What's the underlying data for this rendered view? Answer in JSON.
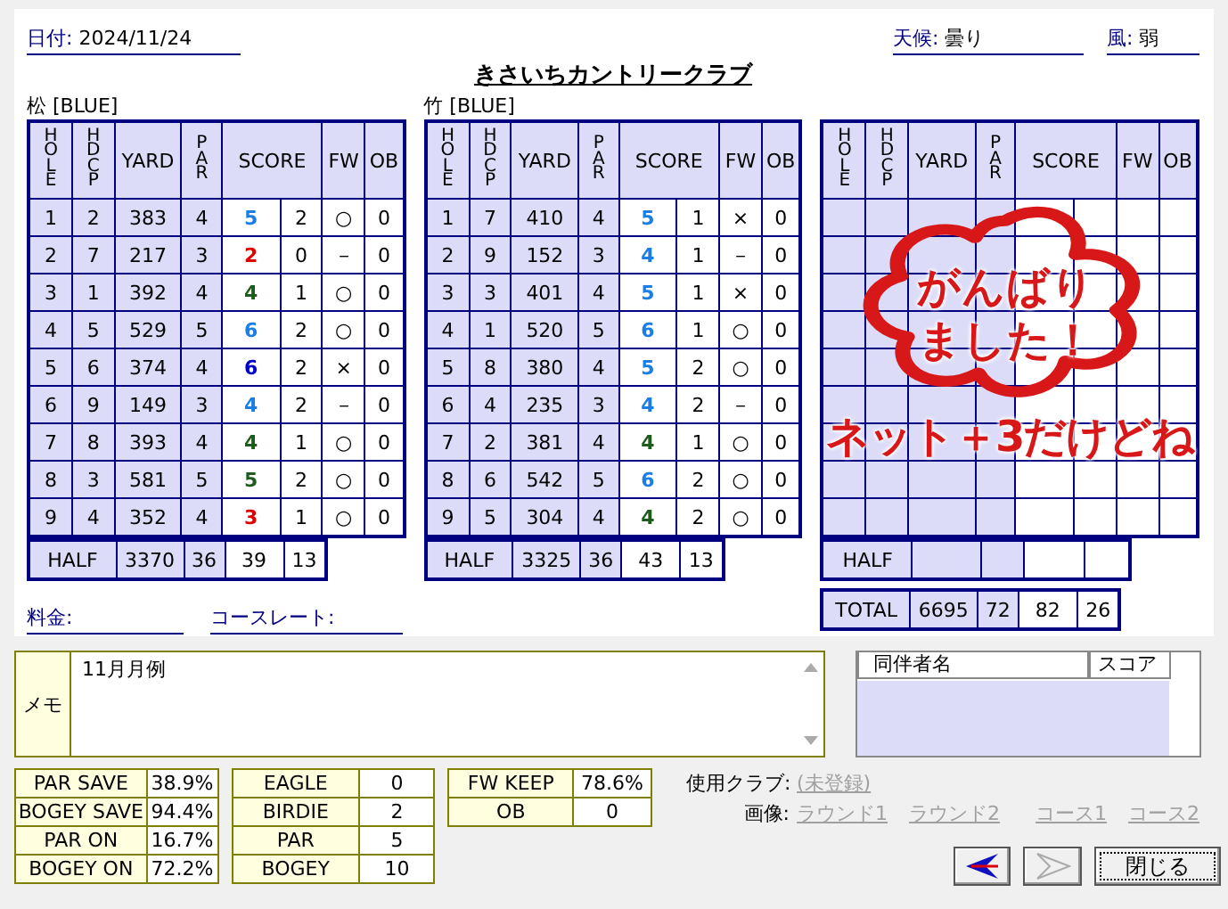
{
  "header": {
    "date_label": "日付:",
    "date": "2024/11/24",
    "weather_label": "天候:",
    "weather": "曇り",
    "wind_label": "風:",
    "wind": "弱"
  },
  "course_name": "きさいちカントリークラブ",
  "cards": [
    {
      "title": "松 [BLUE]",
      "columns": [
        "HOLE",
        "HDCP",
        "YARD",
        "PAR",
        "SCORE",
        "FW",
        "OB"
      ],
      "holes": [
        {
          "hole": "1",
          "hdcp": "2",
          "yard": "383",
          "par": "4",
          "score": "5",
          "putts": "2",
          "fw": "○",
          "ob": "0",
          "color": "#1a7ee6"
        },
        {
          "hole": "2",
          "hdcp": "7",
          "yard": "217",
          "par": "3",
          "score": "2",
          "putts": "0",
          "fw": "－",
          "ob": "0",
          "color": "#e00000"
        },
        {
          "hole": "3",
          "hdcp": "1",
          "yard": "392",
          "par": "4",
          "score": "4",
          "putts": "1",
          "fw": "○",
          "ob": "0",
          "color": "#1e5c1e"
        },
        {
          "hole": "4",
          "hdcp": "5",
          "yard": "529",
          "par": "5",
          "score": "6",
          "putts": "2",
          "fw": "○",
          "ob": "0",
          "color": "#1a7ee6"
        },
        {
          "hole": "5",
          "hdcp": "6",
          "yard": "374",
          "par": "4",
          "score": "6",
          "putts": "2",
          "fw": "×",
          "ob": "0",
          "color": "#0000cc"
        },
        {
          "hole": "6",
          "hdcp": "9",
          "yard": "149",
          "par": "3",
          "score": "4",
          "putts": "2",
          "fw": "－",
          "ob": "0",
          "color": "#1a7ee6"
        },
        {
          "hole": "7",
          "hdcp": "8",
          "yard": "393",
          "par": "4",
          "score": "4",
          "putts": "1",
          "fw": "○",
          "ob": "0",
          "color": "#1e5c1e"
        },
        {
          "hole": "8",
          "hdcp": "3",
          "yard": "581",
          "par": "5",
          "score": "5",
          "putts": "2",
          "fw": "○",
          "ob": "0",
          "color": "#1e5c1e"
        },
        {
          "hole": "9",
          "hdcp": "4",
          "yard": "352",
          "par": "4",
          "score": "3",
          "putts": "1",
          "fw": "○",
          "ob": "0",
          "color": "#e00000"
        }
      ],
      "half": {
        "label": "HALF",
        "yard": "3370",
        "par": "36",
        "score": "39",
        "putts": "13"
      }
    },
    {
      "title": "竹 [BLUE]",
      "columns": [
        "HOLE",
        "HDCP",
        "YARD",
        "PAR",
        "SCORE",
        "FW",
        "OB"
      ],
      "holes": [
        {
          "hole": "1",
          "hdcp": "7",
          "yard": "410",
          "par": "4",
          "score": "5",
          "putts": "1",
          "fw": "×",
          "ob": "0",
          "color": "#1a7ee6"
        },
        {
          "hole": "2",
          "hdcp": "9",
          "yard": "152",
          "par": "3",
          "score": "4",
          "putts": "1",
          "fw": "－",
          "ob": "0",
          "color": "#1a7ee6"
        },
        {
          "hole": "3",
          "hdcp": "3",
          "yard": "401",
          "par": "4",
          "score": "5",
          "putts": "1",
          "fw": "×",
          "ob": "0",
          "color": "#1a7ee6"
        },
        {
          "hole": "4",
          "hdcp": "1",
          "yard": "520",
          "par": "5",
          "score": "6",
          "putts": "1",
          "fw": "○",
          "ob": "0",
          "color": "#1a7ee6"
        },
        {
          "hole": "5",
          "hdcp": "8",
          "yard": "380",
          "par": "4",
          "score": "5",
          "putts": "2",
          "fw": "○",
          "ob": "0",
          "color": "#1a7ee6"
        },
        {
          "hole": "6",
          "hdcp": "4",
          "yard": "235",
          "par": "3",
          "score": "4",
          "putts": "2",
          "fw": "－",
          "ob": "0",
          "color": "#1a7ee6"
        },
        {
          "hole": "7",
          "hdcp": "2",
          "yard": "381",
          "par": "4",
          "score": "4",
          "putts": "1",
          "fw": "○",
          "ob": "0",
          "color": "#1e5c1e"
        },
        {
          "hole": "8",
          "hdcp": "6",
          "yard": "542",
          "par": "5",
          "score": "6",
          "putts": "2",
          "fw": "○",
          "ob": "0",
          "color": "#1a7ee6"
        },
        {
          "hole": "9",
          "hdcp": "5",
          "yard": "304",
          "par": "4",
          "score": "4",
          "putts": "2",
          "fw": "○",
          "ob": "0",
          "color": "#1e5c1e"
        }
      ],
      "half": {
        "label": "HALF",
        "yard": "3325",
        "par": "36",
        "score": "43",
        "putts": "13"
      }
    },
    {
      "columns": [
        "HOLE",
        "HDCP",
        "YARD",
        "PAR",
        "SCORE",
        "FW",
        "OB"
      ],
      "half": {
        "label": "HALF"
      }
    }
  ],
  "total": {
    "label": "TOTAL",
    "yard": "6695",
    "par": "72",
    "score": "82",
    "putts": "26"
  },
  "fee_label": "料金:",
  "course_rate_label": "コースレート:",
  "stamp": {
    "lines": [
      "がんばり",
      "ました！"
    ],
    "note": "ネット＋3だけどね"
  },
  "memo": {
    "label": "メモ",
    "value": "11月月例"
  },
  "companions": {
    "columns": [
      "同伴者名",
      "スコア"
    ]
  },
  "stats": [
    [
      {
        "label": "PAR SAVE",
        "value": "38.9%"
      },
      {
        "label": "BOGEY SAVE",
        "value": "94.4%"
      },
      {
        "label": "PAR ON",
        "value": "16.7%"
      },
      {
        "label": "BOGEY ON",
        "value": "72.2%"
      }
    ],
    [
      {
        "label": "EAGLE",
        "value": "0"
      },
      {
        "label": "BIRDIE",
        "value": "2"
      },
      {
        "label": "PAR",
        "value": "5"
      },
      {
        "label": "BOGEY",
        "value": "10"
      }
    ],
    [
      {
        "label": "FW KEEP",
        "value": "78.6%"
      },
      {
        "label": "OB",
        "value": "0"
      }
    ]
  ],
  "club": {
    "label": "使用クラブ:",
    "value": "(未登録)"
  },
  "images": {
    "label": "画像:",
    "links": [
      "ラウンド1",
      "ラウンド2",
      "コース1",
      "コース2"
    ]
  },
  "nav": {
    "prev_disabled": false,
    "next_disabled": true,
    "close": "閉じる"
  }
}
